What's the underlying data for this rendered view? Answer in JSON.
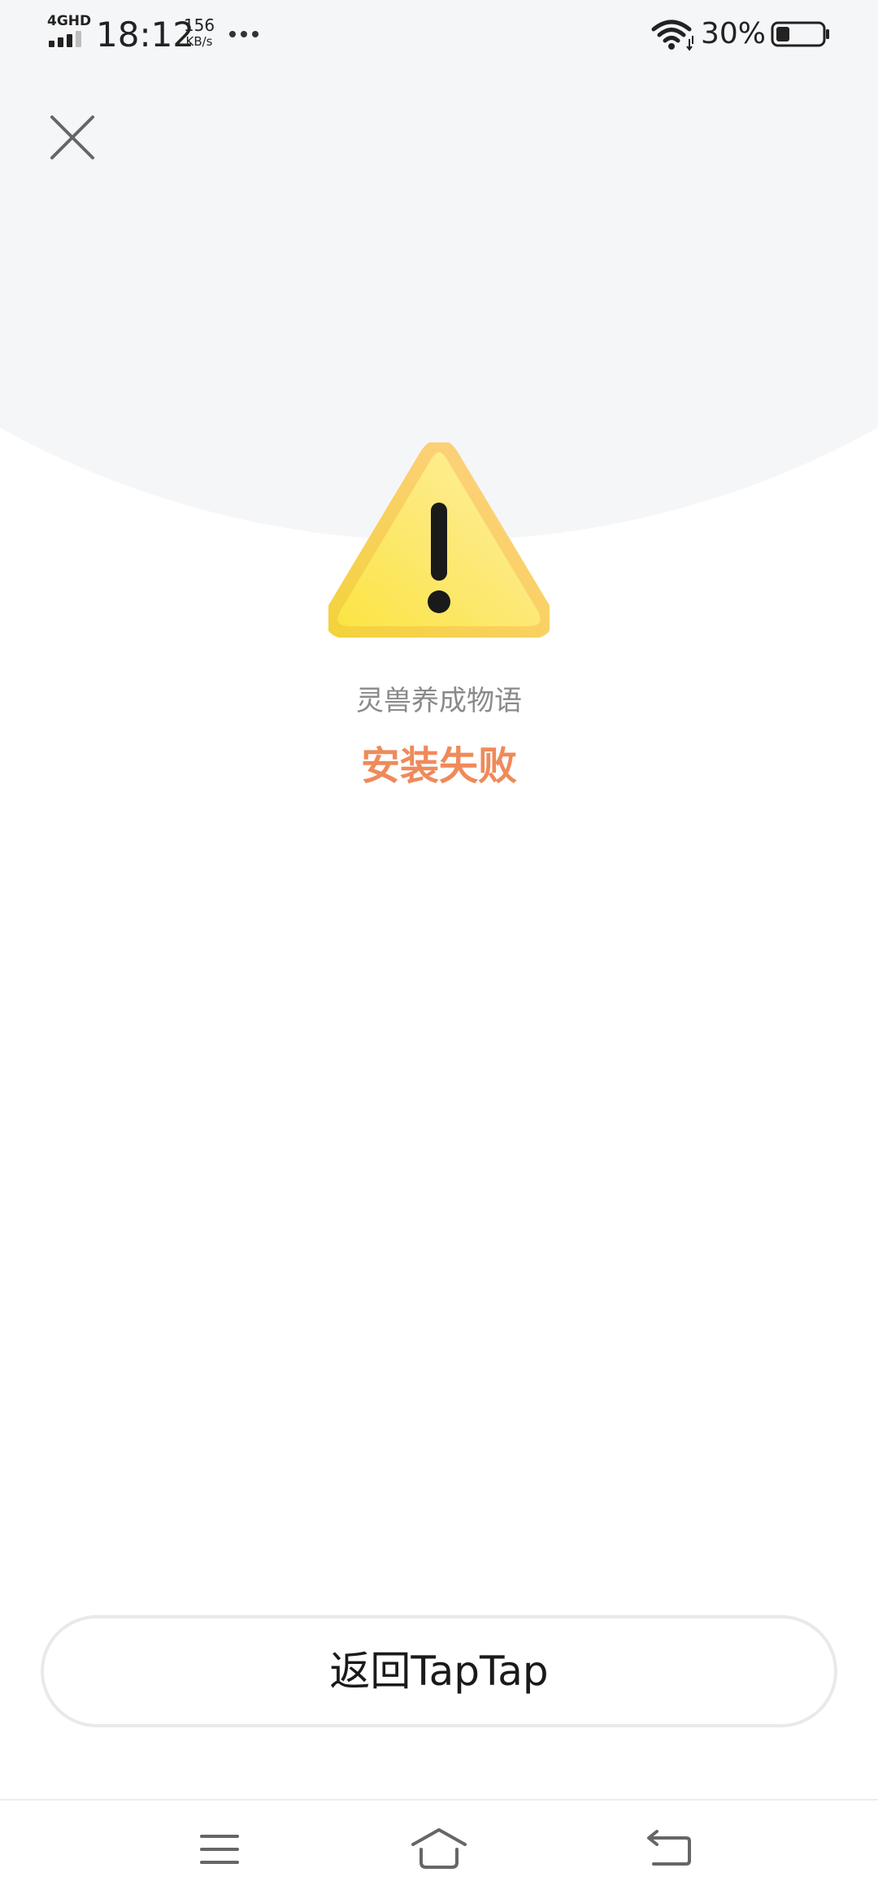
{
  "status_bar": {
    "network": "4GHD",
    "time": "18:12",
    "speed_value": "156",
    "speed_unit": "KB/s",
    "battery_percent": "30%",
    "battery_level": 0.3
  },
  "app": {
    "name": "灵兽养成物语",
    "status": "安装失败"
  },
  "actions": {
    "return_label": "返回TapTap"
  },
  "icons": {
    "close": "close-icon",
    "warning": "warning-triangle-icon",
    "menu": "menu-icon",
    "home": "home-icon",
    "back": "back-icon"
  },
  "colors": {
    "status_accent": "#ef8a5a",
    "warning_yellow": "#fbe440",
    "top_background": "#f5f6f8"
  }
}
